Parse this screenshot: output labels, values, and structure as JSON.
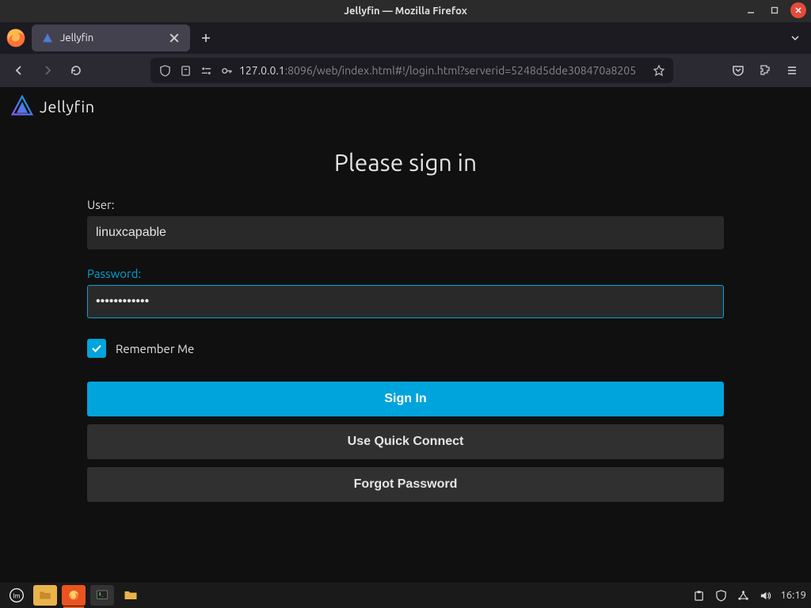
{
  "window": {
    "title": "Jellyfin — Mozilla Firefox"
  },
  "tab": {
    "title": "Jellyfin"
  },
  "urlbar": {
    "host": "127.0.0.1",
    "rest": ":8096/web/index.html#!/login.html?serverid=5248d5dde308470a8205"
  },
  "jellyfin": {
    "brand": "Jellyfin",
    "heading": "Please sign in",
    "user_label": "User:",
    "user_value": "linuxcapable",
    "password_label": "Password:",
    "password_value": "••••••••••••",
    "remember_label": "Remember Me",
    "signin_label": "Sign In",
    "quickconnect_label": "Use Quick Connect",
    "forgot_label": "Forgot Password"
  },
  "taskbar": {
    "clock": "16:19"
  },
  "colors": {
    "accent": "#00a4dc"
  }
}
